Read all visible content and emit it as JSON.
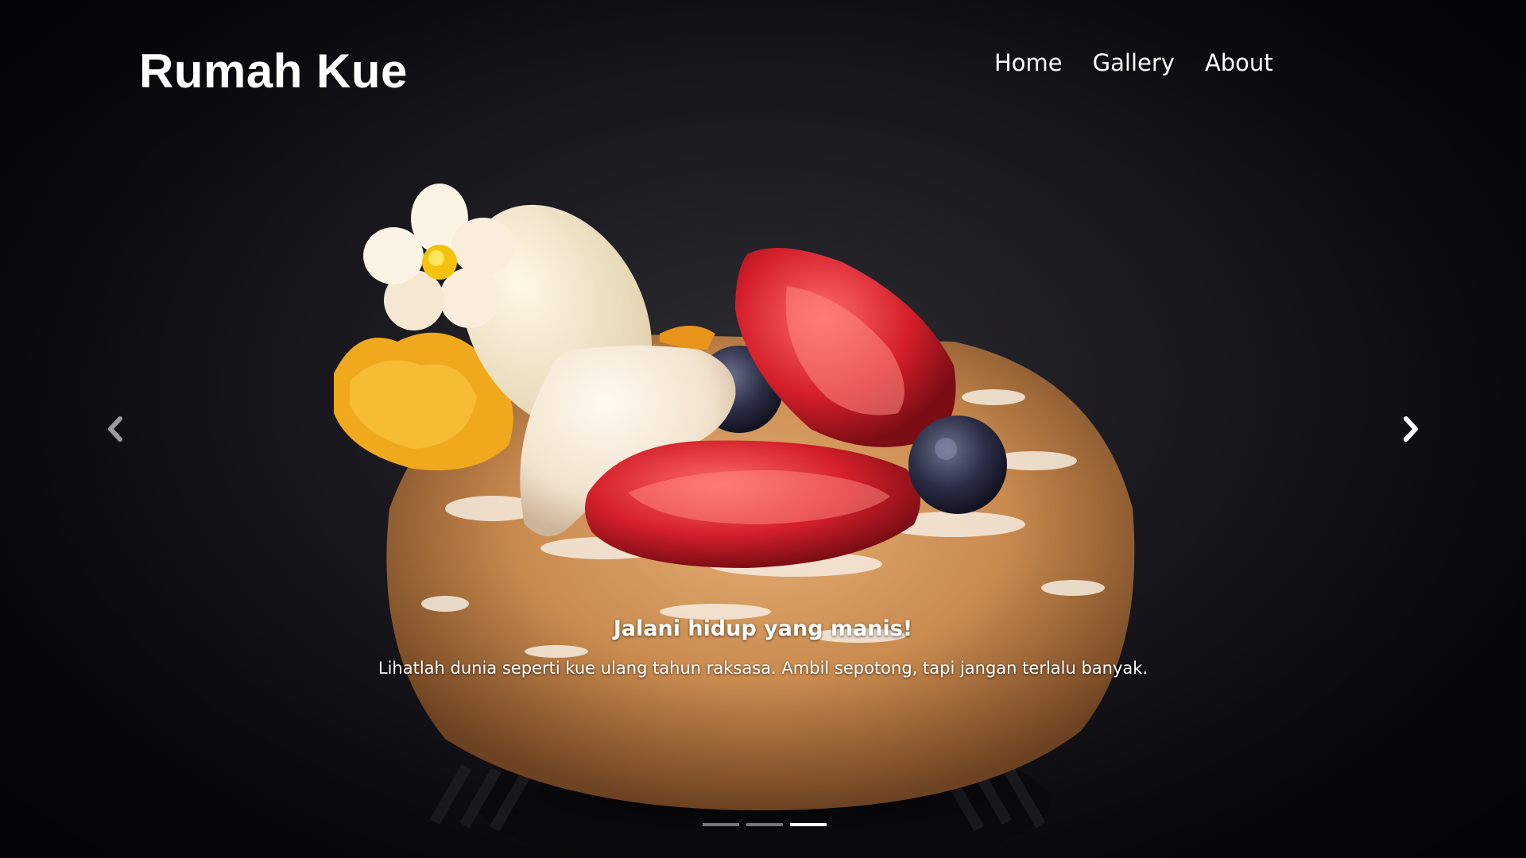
{
  "header": {
    "brand": "Rumah Kue",
    "nav": [
      "Home",
      "Gallery",
      "About"
    ]
  },
  "carousel": {
    "caption_title": "Jalani hidup yang manis!",
    "caption_text": "Lihatlah dunia seperti kue ulang tahun raksasa. Ambil sepotong, tapi jangan terlalu banyak.",
    "slide_count": 3,
    "active_index": 2,
    "prev_icon": "chevron-left-icon",
    "next_icon": "chevron-right-icon"
  },
  "colors": {
    "background": "#0b0b10",
    "text": "#ffffff",
    "indicator_inactive": "rgba(255,255,255,0.45)",
    "indicator_active": "#ffffff"
  }
}
